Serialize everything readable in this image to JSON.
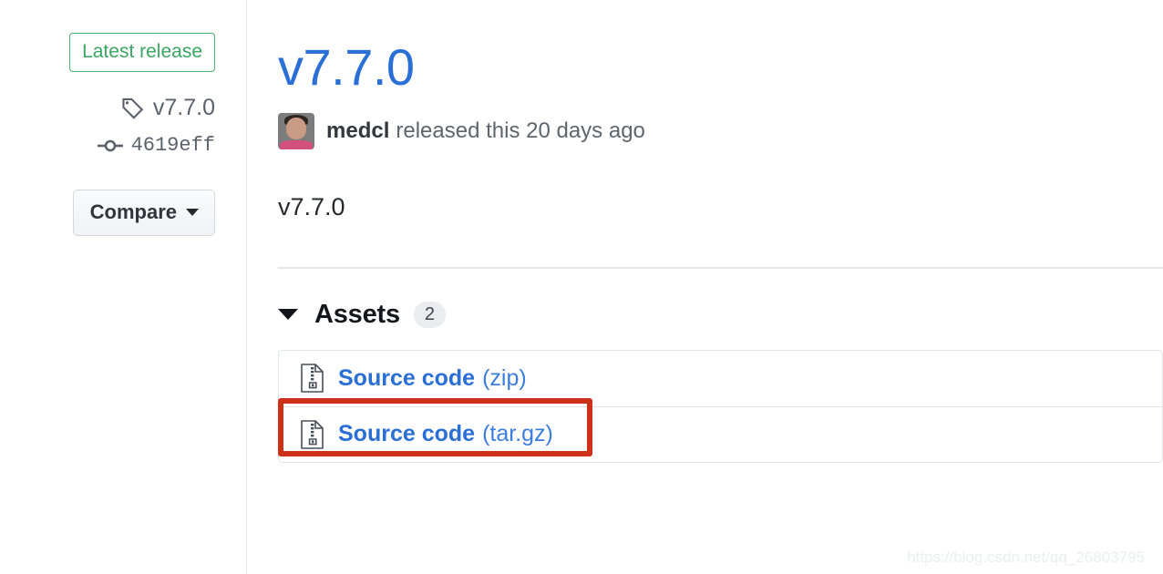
{
  "sidebar": {
    "latest_release_badge": "Latest release",
    "tag": {
      "icon": "tag-icon",
      "label": "v7.7.0"
    },
    "commit": {
      "icon": "git-commit-icon",
      "label": "4619eff"
    },
    "compare_button": {
      "label": "Compare",
      "caret_icon": "chevron-down-icon"
    }
  },
  "release": {
    "title": "v7.7.0",
    "author": "medcl",
    "published_text": "released this 20 days ago",
    "body": "v7.7.0"
  },
  "assets": {
    "caret_icon": "triangle-down-icon",
    "label": "Assets",
    "count": "2",
    "items": [
      {
        "icon": "file-zip-icon",
        "name": "Source code",
        "ext": "(zip)"
      },
      {
        "icon": "file-zip-icon",
        "name": "Source code",
        "ext": "(tar.gz)"
      }
    ]
  },
  "annotation": {
    "color": "#cd3219",
    "target": "source-code-zip-row"
  },
  "watermark": "https://blog.csdn.net/qq_26803795",
  "colors": {
    "link_blue": "#2a6fd6",
    "badge_green": "#3aa662",
    "text_dark": "#24292e",
    "text_muted": "#5e656d",
    "border": "#e1e4e8"
  }
}
